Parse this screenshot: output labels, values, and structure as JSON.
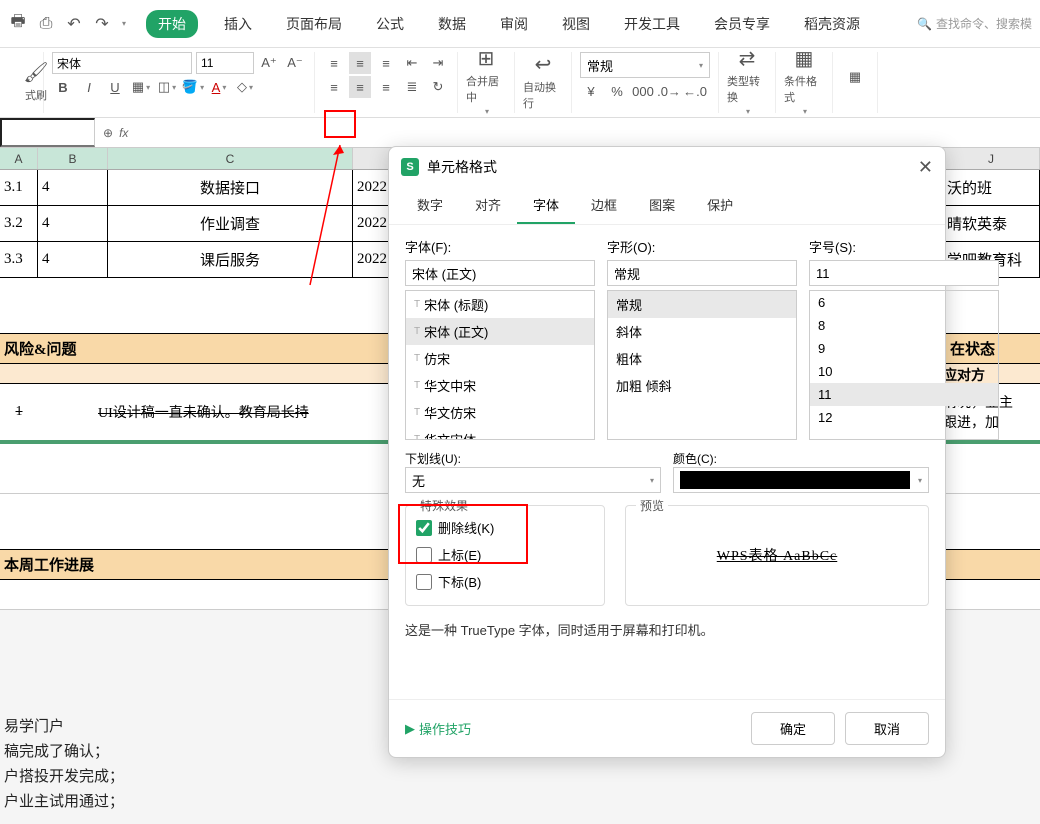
{
  "tabs": {
    "start": "开始",
    "insert": "插入",
    "layout": "页面布局",
    "formula": "公式",
    "data": "数据",
    "review": "审阅",
    "view": "视图",
    "dev": "开发工具",
    "member": "会员专享",
    "docer": "稻壳资源"
  },
  "search_placeholder": "查找命令、搜索模",
  "ribbon": {
    "format_painter": "式刷",
    "font_name": "宋体",
    "font_size": "11",
    "merge": "合并居中",
    "wrap": "自动换行",
    "numfmt": "常规",
    "type_conv": "类型转换",
    "cond_fmt": "条件格式"
  },
  "cols": {
    "A": "A",
    "B": "B",
    "C": "C",
    "J": "J"
  },
  "rows": [
    {
      "a": "3.1",
      "b": "4",
      "c": "数据接口",
      "d": "2022",
      "j": "沃的班"
    },
    {
      "a": "3.2",
      "b": "4",
      "c": "作业调查",
      "d": "2022",
      "j": "晴软英泰"
    },
    {
      "a": "3.3",
      "b": "4",
      "c": "课后服务",
      "d": "2022",
      "j": "学吧教育科"
    }
  ],
  "section1": "风险&问题",
  "section1_right": "在状态",
  "section1_sub_right": "应对方",
  "risk_num": "1",
  "risk_text": "UI设计稿一直未确认。教育局长持",
  "risk_right1": "情况，业主",
  "risk_right2": "跟进，加",
  "section2": "本周工作进展",
  "bottom_lines": {
    "l1": "易学门户",
    "l2": "稿完成了确认；",
    "l3": "户搭投开发完成；",
    "l4": "户业主试用通过；"
  },
  "dialog": {
    "title": "单元格格式",
    "tabs": {
      "num": "数字",
      "align": "对齐",
      "font": "字体",
      "border": "边框",
      "pattern": "图案",
      "protect": "保护"
    },
    "font_label": "字体(F):",
    "style_label": "字形(O):",
    "size_label": "字号(S):",
    "font_value": "宋体 (正文)",
    "style_value": "常规",
    "size_value": "11",
    "font_list": [
      "宋体 (标题)",
      "宋体 (正文)",
      "仿宋",
      "华文中宋",
      "华文仿宋",
      "华文宋体"
    ],
    "style_list": [
      "常规",
      "斜体",
      "粗体",
      "加粗 倾斜"
    ],
    "size_list": [
      "6",
      "8",
      "9",
      "10",
      "11",
      "12"
    ],
    "underline_label": "下划线(U):",
    "underline_value": "无",
    "color_label": "颜色(C):",
    "fx_legend": "特殊效果",
    "strike": "删除线(K)",
    "super": "上标(E)",
    "sub": "下标(B)",
    "preview_legend": "预览",
    "preview_text": "WPS表格   AaBbCc",
    "desc": "这是一种 TrueType 字体，同时适用于屏幕和打印机。",
    "tips": "操作技巧",
    "ok": "确定",
    "cancel": "取消"
  }
}
